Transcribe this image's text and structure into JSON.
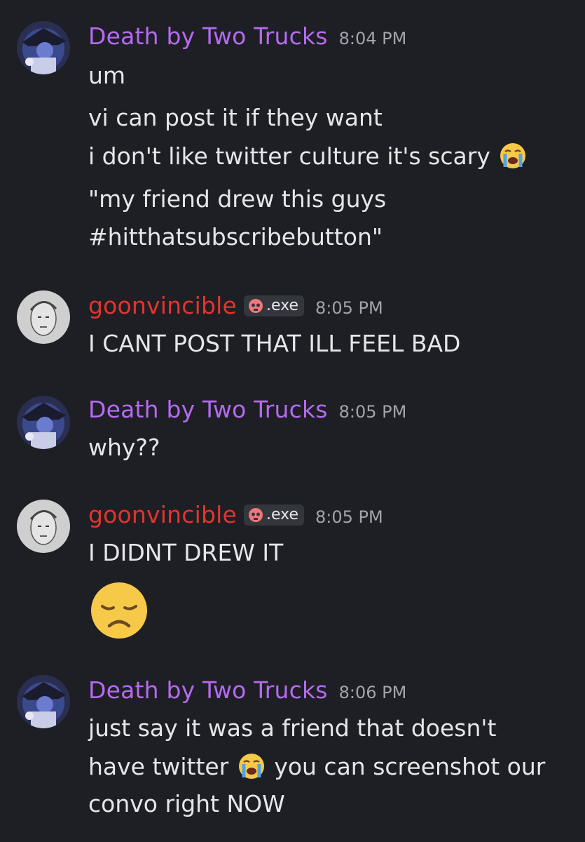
{
  "messages": [
    {
      "author": "Death by Two Trucks",
      "time": "8:04 PM",
      "lines": [
        "um",
        "vi can post it if they want",
        "i don't like twitter culture it's scary",
        "\"my friend drew this guys",
        "#hitthatsubscribebutton\""
      ]
    },
    {
      "author": "goonvincible",
      "tag": ".exe",
      "time": "8:05 PM",
      "lines": [
        "I CANT POST THAT ILL FEEL BAD"
      ]
    },
    {
      "author": "Death by Two Trucks",
      "time": "8:05 PM",
      "lines": [
        "why??"
      ]
    },
    {
      "author": "goonvincible",
      "tag": ".exe",
      "time": "8:05 PM",
      "lines": [
        "I DIDNT DREW IT"
      ],
      "emoji": "disappointed-face-emoji"
    },
    {
      "author": "Death by Two Trucks",
      "time": "8:06 PM",
      "lines": [
        "just say it was a friend that doesn't",
        "have twitter",
        "you can screenshot our",
        "convo right NOW"
      ]
    }
  ],
  "colors": {
    "background": "#1e1f24",
    "death_name": "#b56af0",
    "goon_name": "#e3342f",
    "timestamp": "#a2a4ac"
  },
  "icons": {
    "crying": "loudly-crying-face-emoji",
    "skull": "skull-icon"
  }
}
